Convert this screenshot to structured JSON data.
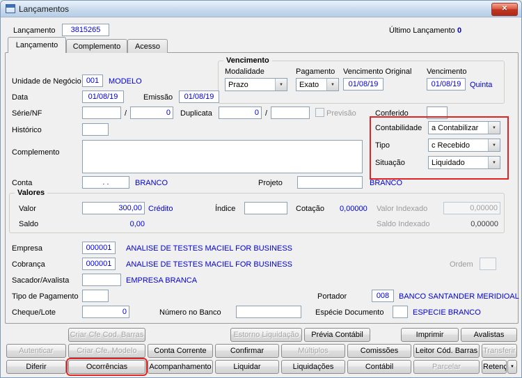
{
  "window": {
    "title": "Lançamentos"
  },
  "icons": {
    "close": "✕",
    "combo_arrow": "▼",
    "split_arrow": "▼"
  },
  "colors": {
    "highlight_red": "#e02424",
    "value_blue": "#0000d4",
    "titlebar": "#bfd4ea"
  },
  "header": {
    "lancamento_label": "Lançamento",
    "lancamento_value": "3815265",
    "ultimo_lancamento_label": "Último Lançamento",
    "ultimo_lancamento_value": "0"
  },
  "tabs": [
    {
      "label": "Lançamento"
    },
    {
      "label": "Complemento"
    },
    {
      "label": "Acesso"
    }
  ],
  "form": {
    "barra": "/",
    "unidade_negocio_label": "Unidade de Negócio",
    "unidade_negocio_value": "001",
    "unidade_negocio_desc": "MODELO",
    "vencimento": {
      "title": "Vencimento",
      "modalidade_label": "Modalidade",
      "modalidade_value": "Prazo",
      "pagamento_label": "Pagamento",
      "pagamento_value": "Exato",
      "original_label": "Vencimento Original",
      "original_value": "01/08/19",
      "vencimento_label": "Vencimento",
      "vencimento_value": "01/08/19",
      "dia_semana": "Quinta"
    },
    "data_label": "Data",
    "data_value": "01/08/19",
    "emissao_label": "Emissão",
    "emissao_value": "01/08/19",
    "serie_nf_label": "Série/NF",
    "serie_nf_value1": "",
    "serie_nf_value2": "0",
    "duplicata_label": "Duplicata",
    "duplicata_value1": "0",
    "duplicata_value2": "",
    "previsao_label": "Previsão",
    "conferido_label": "Conferido",
    "conferido_value": "",
    "historico_label": "Histórico",
    "historico_value": "",
    "situacao_box": {
      "contabilidade_label": "Contabilidade",
      "contabilidade_value": "a Contabilizar",
      "tipo_label": "Tipo",
      "tipo_value": "c Recebido",
      "situacao_label": "Situação",
      "situacao_value": "Liquidado"
    },
    "complemento_label": "Complemento",
    "complemento_value": "",
    "conta_label": "Conta",
    "conta_value": ". .",
    "conta_desc": "BRANCO",
    "projeto_label": "Projeto",
    "projeto_value": "",
    "projeto_desc": "BRANCO",
    "valores": {
      "title": "Valores",
      "valor_label": "Valor",
      "valor_value": "300,00",
      "valor_tipo": "Crédito",
      "indice_label": "Índice",
      "indice_value": "",
      "cotacao_label": "Cotação",
      "cotacao_value": "0,00000",
      "valor_indexado_label": "Valor Indexado",
      "valor_indexado_value": "0,00000",
      "saldo_label": "Saldo",
      "saldo_value": "0,00",
      "saldo_indexado_label": "Saldo Indexado",
      "saldo_indexado_value": "0,00000"
    },
    "empresa_label": "Empresa",
    "empresa_value": "000001",
    "empresa_desc": "ANALISE DE TESTES MACIEL FOR BUSINESS",
    "cobranca_label": "Cobrança",
    "cobranca_value": "000001",
    "cobranca_desc": "ANALISE DE TESTES MACIEL FOR BUSINESS",
    "ordem_label": "Ordem",
    "ordem_value": "",
    "sacador_avalista_label": "Sacador/Avalista",
    "sacador_avalista_value": "",
    "sacador_avalista_desc": "EMPRESA BRANCA",
    "tipo_pagamento_label": "Tipo de Pagamento",
    "tipo_pagamento_value": "",
    "portador_label": "Portador",
    "portador_value": "008",
    "portador_desc": "BANCO SANTANDER MERIDIOAL",
    "cheque_lote_label": "Cheque/Lote",
    "cheque_lote_value": "0",
    "numero_banco_label": "Número no Banco",
    "numero_banco_value": "",
    "especie_documento_label": "Espécie Documento",
    "especie_documento_value": "",
    "especie_documento_desc": "ESPECIE BRANCO"
  },
  "buttons": {
    "criar_cfe_cod_barras": "Criar Cfe Cod. Barras",
    "estorno_liquidacao": "Estorno Liquidação",
    "previa_contabil": "Prévia Contábil",
    "imprimir": "Imprimir",
    "avalistas": "Avalistas",
    "autenticar": "Autenticar",
    "criar_cfe_modelo": "Criar Cfe. Modelo",
    "conta_corrente": "Conta Corrente",
    "confirmar": "Confirmar",
    "multiplos": "Múltiplos",
    "comissoes": "Comissões",
    "leitor_cod_barras": "Leitor Cód. Barras",
    "transferir": "Transferir",
    "diferir": "Diferir",
    "ocorrencias": "Ocorrências",
    "acompanhamento": "Acompanhamento",
    "liquidar": "Liquidar",
    "liquidacoes": "Liquidações",
    "contabil": "Contábil",
    "parcelar": "Parcelar",
    "retencao": "Retenção"
  }
}
